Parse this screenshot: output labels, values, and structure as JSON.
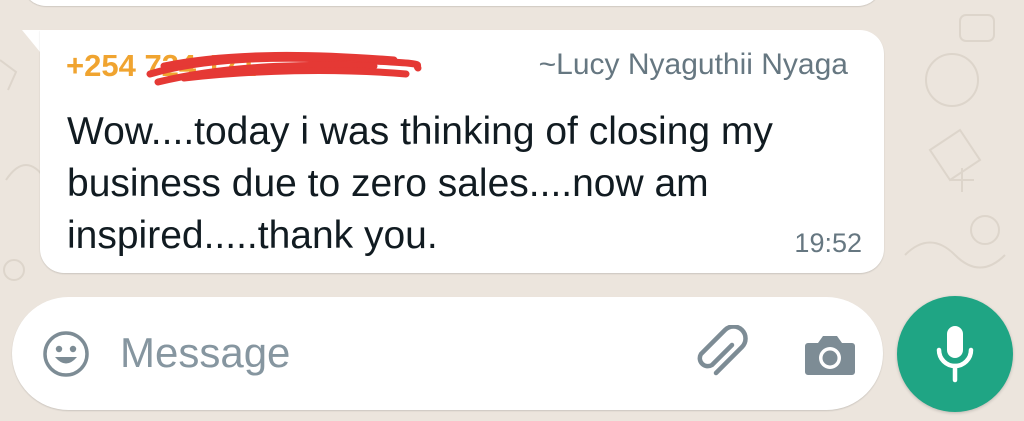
{
  "chat": {
    "message": {
      "sender_phone": "+254 724 171",
      "sender_name": "~Lucy Nyaguthii Nyaga",
      "text": "Wow....today i was thinking of closing my business due to zero sales....now am inspired.....thank you.",
      "time": "19:52"
    }
  },
  "composer": {
    "placeholder": "Message",
    "icons": {
      "emoji": "emoji-icon",
      "attach": "paperclip-icon",
      "camera": "camera-icon",
      "mic": "mic-icon"
    }
  },
  "colors": {
    "background": "#ece5dd",
    "bubble": "#ffffff",
    "sender_phone": "#f0a430",
    "sender_name": "#667781",
    "message_text": "#111b21",
    "accent": "#1fa584",
    "redaction": "#e53935"
  }
}
